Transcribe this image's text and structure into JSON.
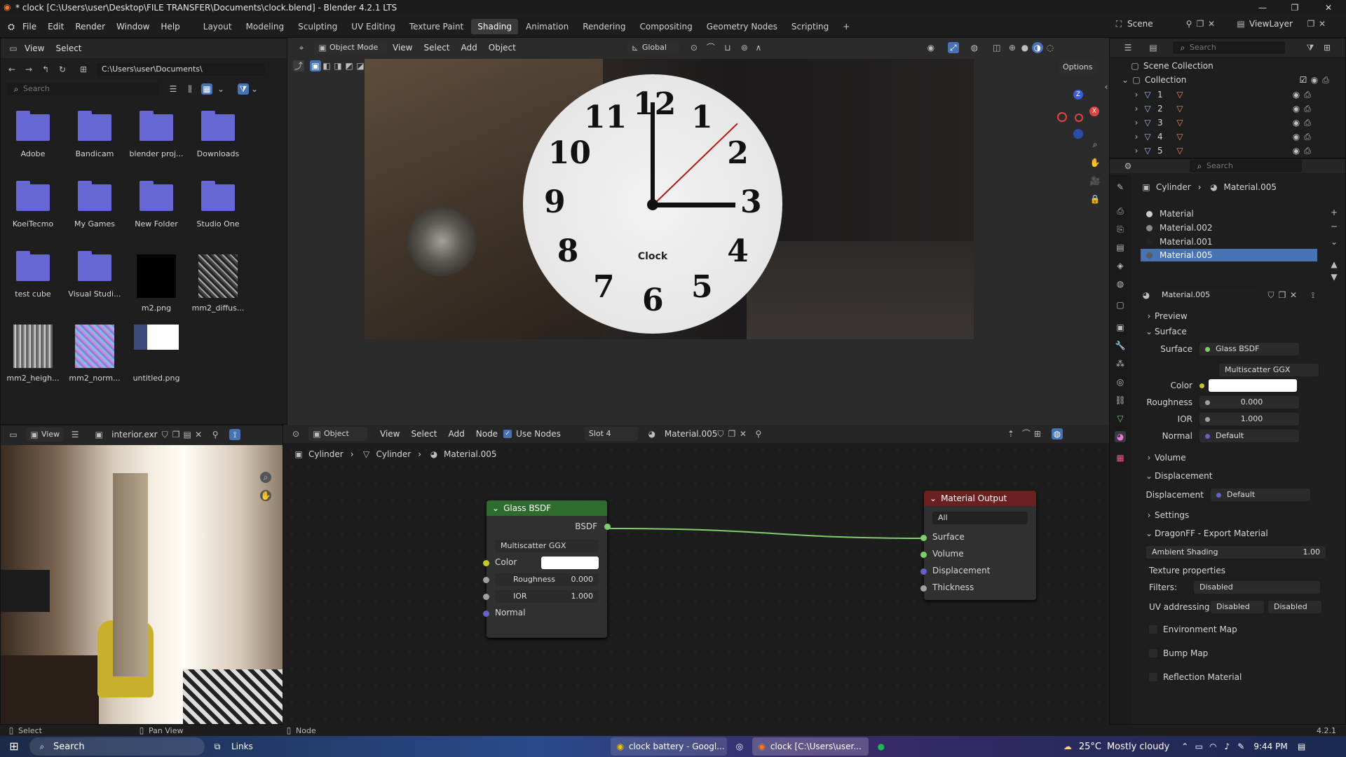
{
  "window": {
    "title": "* clock [C:\\Users\\user\\Desktop\\FILE TRANSFER\\Documents\\clock.blend] - Blender 4.2.1 LTS"
  },
  "menus": [
    "File",
    "Edit",
    "Render",
    "Window",
    "Help"
  ],
  "workspaces": [
    "Layout",
    "Modeling",
    "Sculpting",
    "UV Editing",
    "Texture Paint",
    "Shading",
    "Animation",
    "Rendering",
    "Compositing",
    "Geometry Nodes",
    "Scripting"
  ],
  "active_workspace": "Shading",
  "scene": {
    "label": "Scene",
    "viewlayer": "ViewLayer"
  },
  "filebrowser": {
    "view": "View",
    "select": "Select",
    "path": "C:\\Users\\user\\Documents\\",
    "search_placeholder": "Search",
    "items": [
      "Adobe",
      "Bandicam",
      "blender proj...",
      "Downloads",
      "KoeiTecmo",
      "My Games",
      "New Folder",
      "Studio One",
      "test cube",
      "Visual Studi...",
      "m2.png",
      "mm2_diffus...",
      "mm2_heigh...",
      "mm2_norm...",
      "untitled.png"
    ]
  },
  "viewport": {
    "mode": "Object Mode",
    "view": "View",
    "select": "Select",
    "add": "Add",
    "object": "Object",
    "transform": "Global",
    "options": "Options"
  },
  "clock": {
    "label": "Clock",
    "numerals": [
      "12",
      "1",
      "2",
      "3",
      "4",
      "5",
      "6",
      "7",
      "8",
      "9",
      "10",
      "11"
    ]
  },
  "outliner": {
    "search_placeholder": "Search",
    "scene_collection": "Scene Collection",
    "collection": "Collection",
    "objects": [
      "1",
      "2",
      "3",
      "4",
      "5"
    ]
  },
  "properties": {
    "search_placeholder": "Search",
    "breadcrumb_object": "Cylinder",
    "breadcrumb_material": "Material.005",
    "materials": [
      "Material",
      "Material.002",
      "Material.001",
      "Material.005"
    ],
    "active_material": "Material.005",
    "preview": "Preview",
    "surface_section": "Surface",
    "surface_label": "Surface",
    "surface_value": "Glass BSDF",
    "distribution": "Multiscatter GGX",
    "color_label": "Color",
    "roughness_label": "Roughness",
    "roughness": "0.000",
    "ior_label": "IOR",
    "ior": "1.000",
    "normal_label": "Normal",
    "normal_value": "Default",
    "volume": "Volume",
    "displacement_section": "Displacement",
    "displacement_label": "Displacement",
    "displacement_value": "Default",
    "settings": "Settings",
    "dragon": "DragonFF - Export Material",
    "ambient_label": "Ambient Shading",
    "ambient_value": "1.00",
    "texture_props": "Texture properties",
    "filters_label": "Filters:",
    "filters_value": "Disabled",
    "uv_label": "UV addressing",
    "uv_value1": "Disabled",
    "uv_value2": "Disabled",
    "env_map": "Environment Map",
    "bump_map": "Bump Map",
    "reflection": "Reflection Material"
  },
  "image_editor": {
    "view": "View",
    "image": "interior.exr"
  },
  "node_editor": {
    "object": "Object",
    "view": "View",
    "select": "Select",
    "add": "Add",
    "node": "Node",
    "use_nodes": "Use Nodes",
    "slot": "Slot 4",
    "material": "Material.005",
    "breadcrumb": [
      "Cylinder",
      "Cylinder",
      "Material.005"
    ]
  },
  "glass_node": {
    "title": "Glass BSDF",
    "output": "BSDF",
    "distribution": "Multiscatter GGX",
    "color": "Color",
    "roughness_label": "Roughness",
    "roughness": "0.000",
    "ior_label": "IOR",
    "ior": "1.000",
    "normal": "Normal"
  },
  "output_node": {
    "title": "Material Output",
    "target": "All",
    "inputs": [
      "Surface",
      "Volume",
      "Displacement",
      "Thickness"
    ]
  },
  "statusbar": {
    "select": "Select",
    "pan": "Pan View",
    "node": "Node",
    "version": "4.2.1"
  },
  "taskbar": {
    "search": "Search",
    "links": "Links",
    "chrome": "clock battery - Googl...",
    "blender": "clock [C:\\Users\\user...",
    "weather_temp": "25°C",
    "weather_desc": "Mostly cloudy",
    "time": "9:44 PM"
  },
  "colors": {
    "accent": "#4772b3",
    "node_green": "#2e6b2e",
    "link": "#7ece6b",
    "folder": "#6767d6",
    "output_header": "#6b2020"
  }
}
